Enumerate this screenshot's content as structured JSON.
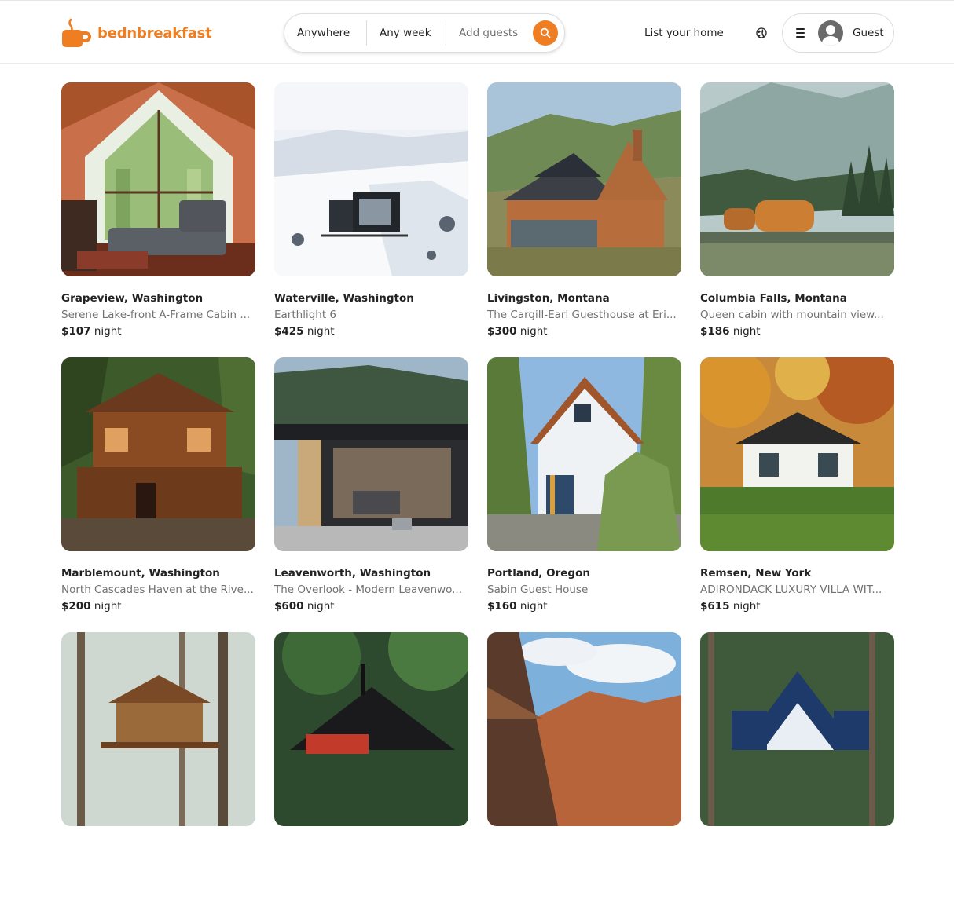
{
  "brand": {
    "name": "bednbreakfast",
    "color": "#ef7d22",
    "icon": "coffee-mug-icon"
  },
  "search": {
    "where": "Anywhere",
    "when": "Any week",
    "who": "Add guests",
    "icon": "search-icon"
  },
  "nav": {
    "list_home": "List your home",
    "globe_icon": "globe-icon",
    "menu_icon": "hamburger-icon",
    "user_label": "Guest"
  },
  "listings": [
    {
      "location": "Grapeview, Washington",
      "title": "Serene Lake-front A-Frame Cabin ...",
      "price": "$107",
      "unit": "night",
      "scene": "aframe-interior"
    },
    {
      "location": "Waterville, Washington",
      "title": "Earthlight 6",
      "price": "$425",
      "unit": "night",
      "scene": "snow-cabin"
    },
    {
      "location": "Livingston, Montana",
      "title": "The Cargill-Earl Guesthouse at Eri...",
      "price": "$300",
      "unit": "night",
      "scene": "solar-house"
    },
    {
      "location": "Columbia Falls, Montana",
      "title": "Queen cabin with mountain view...",
      "price": "$186",
      "unit": "night",
      "scene": "trailer-lake"
    },
    {
      "location": "Marblemount, Washington",
      "title": "North Cascades Haven at the Rive...",
      "price": "$200",
      "unit": "night",
      "scene": "wood-cabin"
    },
    {
      "location": "Leavenworth, Washington",
      "title": "The Overlook - Modern Leavenwo...",
      "price": "$600",
      "unit": "night",
      "scene": "modern-overlook"
    },
    {
      "location": "Portland, Oregon",
      "title": "Sabin Guest House",
      "price": "$160",
      "unit": "night",
      "scene": "white-house"
    },
    {
      "location": "Remsen, New York",
      "title": "ADIRONDACK LUXURY VILLA WIT...",
      "price": "$615",
      "unit": "night",
      "scene": "autumn-villa"
    },
    {
      "location": "",
      "title": "",
      "price": "",
      "unit": "",
      "scene": "treehouse"
    },
    {
      "location": "",
      "title": "",
      "price": "",
      "unit": "",
      "scene": "black-cabin"
    },
    {
      "location": "",
      "title": "",
      "price": "",
      "unit": "",
      "scene": "canyon-aframe"
    },
    {
      "location": "",
      "title": "",
      "price": "",
      "unit": "",
      "scene": "blue-aframe"
    }
  ]
}
